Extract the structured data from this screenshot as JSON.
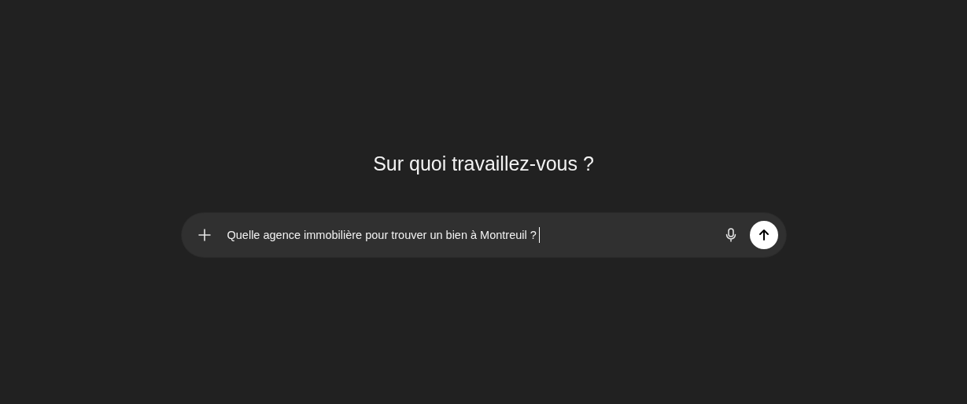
{
  "heading": "Sur quoi travaillez-vous ?",
  "composer": {
    "value": "Quelle agence immobilière pour trouver un bien à Montreuil ?"
  }
}
